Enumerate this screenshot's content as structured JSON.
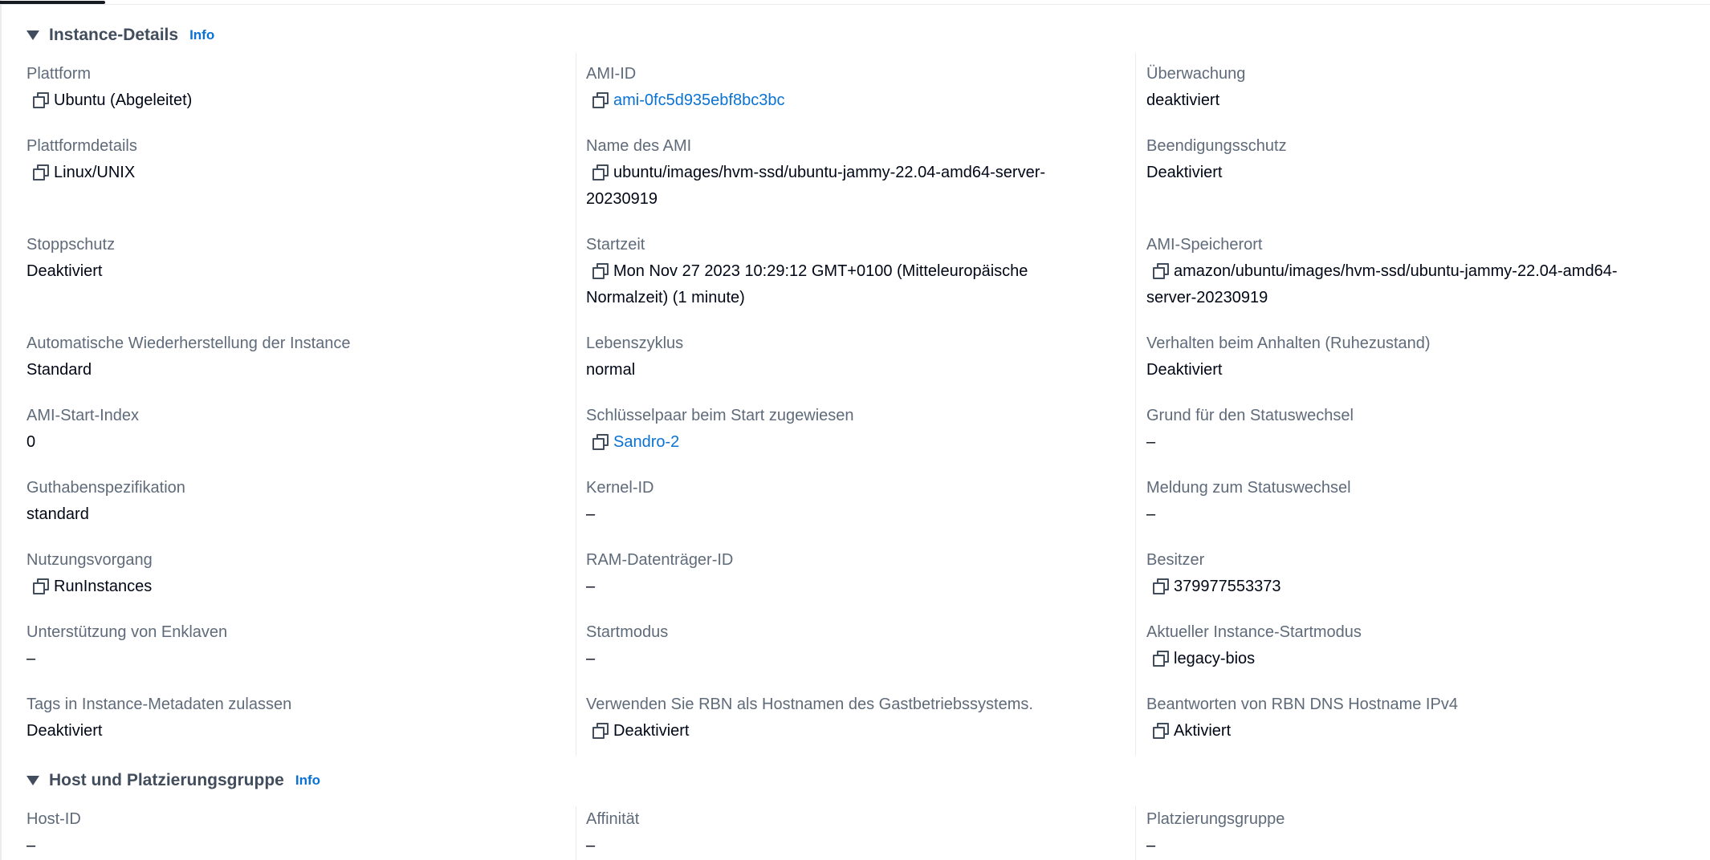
{
  "sections": {
    "instance": {
      "title": "Instance-Details",
      "info": "Info"
    },
    "host": {
      "title": "Host und Platzierungsgruppe",
      "info": "Info"
    }
  },
  "dash": "–",
  "instance_details": {
    "plattform": {
      "label": "Plattform",
      "value": "Ubuntu (Abgeleitet)"
    },
    "ami_id": {
      "label": "AMI-ID",
      "value": "ami-0fc5d935ebf8bc3bc"
    },
    "ueberwachung": {
      "label": "Überwachung",
      "value": "deaktiviert"
    },
    "plattformdetails": {
      "label": "Plattformdetails",
      "value": "Linux/UNIX"
    },
    "ami_name": {
      "label": "Name des AMI",
      "value_line1": "ubuntu/images/hvm-ssd/ubuntu-jammy-22.04-amd64-server-",
      "value_line2": "20230919"
    },
    "beendigungsschutz": {
      "label": "Beendigungsschutz",
      "value": "Deaktiviert"
    },
    "stoppschutz": {
      "label": "Stoppschutz",
      "value": "Deaktiviert"
    },
    "startzeit": {
      "label": "Startzeit",
      "value_line1": "Mon Nov 27 2023 10:29:12 GMT+0100 (Mitteleuropäische",
      "value_line2": "Normalzeit) (1 minute)"
    },
    "ami_speicherort": {
      "label": "AMI-Speicherort",
      "value_line1": "amazon/ubuntu/images/hvm-ssd/ubuntu-jammy-22.04-amd64-",
      "value_line2": "server-20230919"
    },
    "auto_recovery": {
      "label": "Automatische Wiederherstellung der Instance",
      "value": "Standard"
    },
    "lebenszyklus": {
      "label": "Lebenszyklus",
      "value": "normal"
    },
    "anhalten": {
      "label": "Verhalten beim Anhalten (Ruhezustand)",
      "value": "Deaktiviert"
    },
    "ami_start_index": {
      "label": "AMI-Start-Index",
      "value": "0"
    },
    "schluesselpaar": {
      "label": "Schlüsselpaar beim Start zugewiesen",
      "value": "Sandro-2"
    },
    "statuswechsel_grund": {
      "label": "Grund für den Statuswechsel"
    },
    "guthaben": {
      "label": "Guthabenspezifikation",
      "value": "standard"
    },
    "kernel_id": {
      "label": "Kernel-ID"
    },
    "statuswechsel_meldung": {
      "label": "Meldung zum Statuswechsel"
    },
    "nutzungsvorgang": {
      "label": "Nutzungsvorgang",
      "value": "RunInstances"
    },
    "ram_id": {
      "label": "RAM-Datenträger-ID"
    },
    "besitzer": {
      "label": "Besitzer",
      "value": "379977553373"
    },
    "enklaven": {
      "label": "Unterstützung von Enklaven"
    },
    "startmodus": {
      "label": "Startmodus"
    },
    "aktueller_startmodus": {
      "label": "Aktueller Instance-Startmodus",
      "value": "legacy-bios"
    },
    "tags_metadaten": {
      "label": "Tags in Instance-Metadaten zulassen",
      "value": "Deaktiviert"
    },
    "rbn_hostname": {
      "label": "Verwenden Sie RBN als Hostnamen des Gastbetriebssystems.",
      "value": "Deaktiviert"
    },
    "rbn_dns": {
      "label": "Beantworten von RBN DNS Hostname IPv4",
      "value": "Aktiviert"
    }
  },
  "host_details": {
    "host_id": {
      "label": "Host-ID"
    },
    "affinitaet": {
      "label": "Affinität"
    },
    "platzierungsgruppe": {
      "label": "Platzierungsgruppe"
    }
  }
}
